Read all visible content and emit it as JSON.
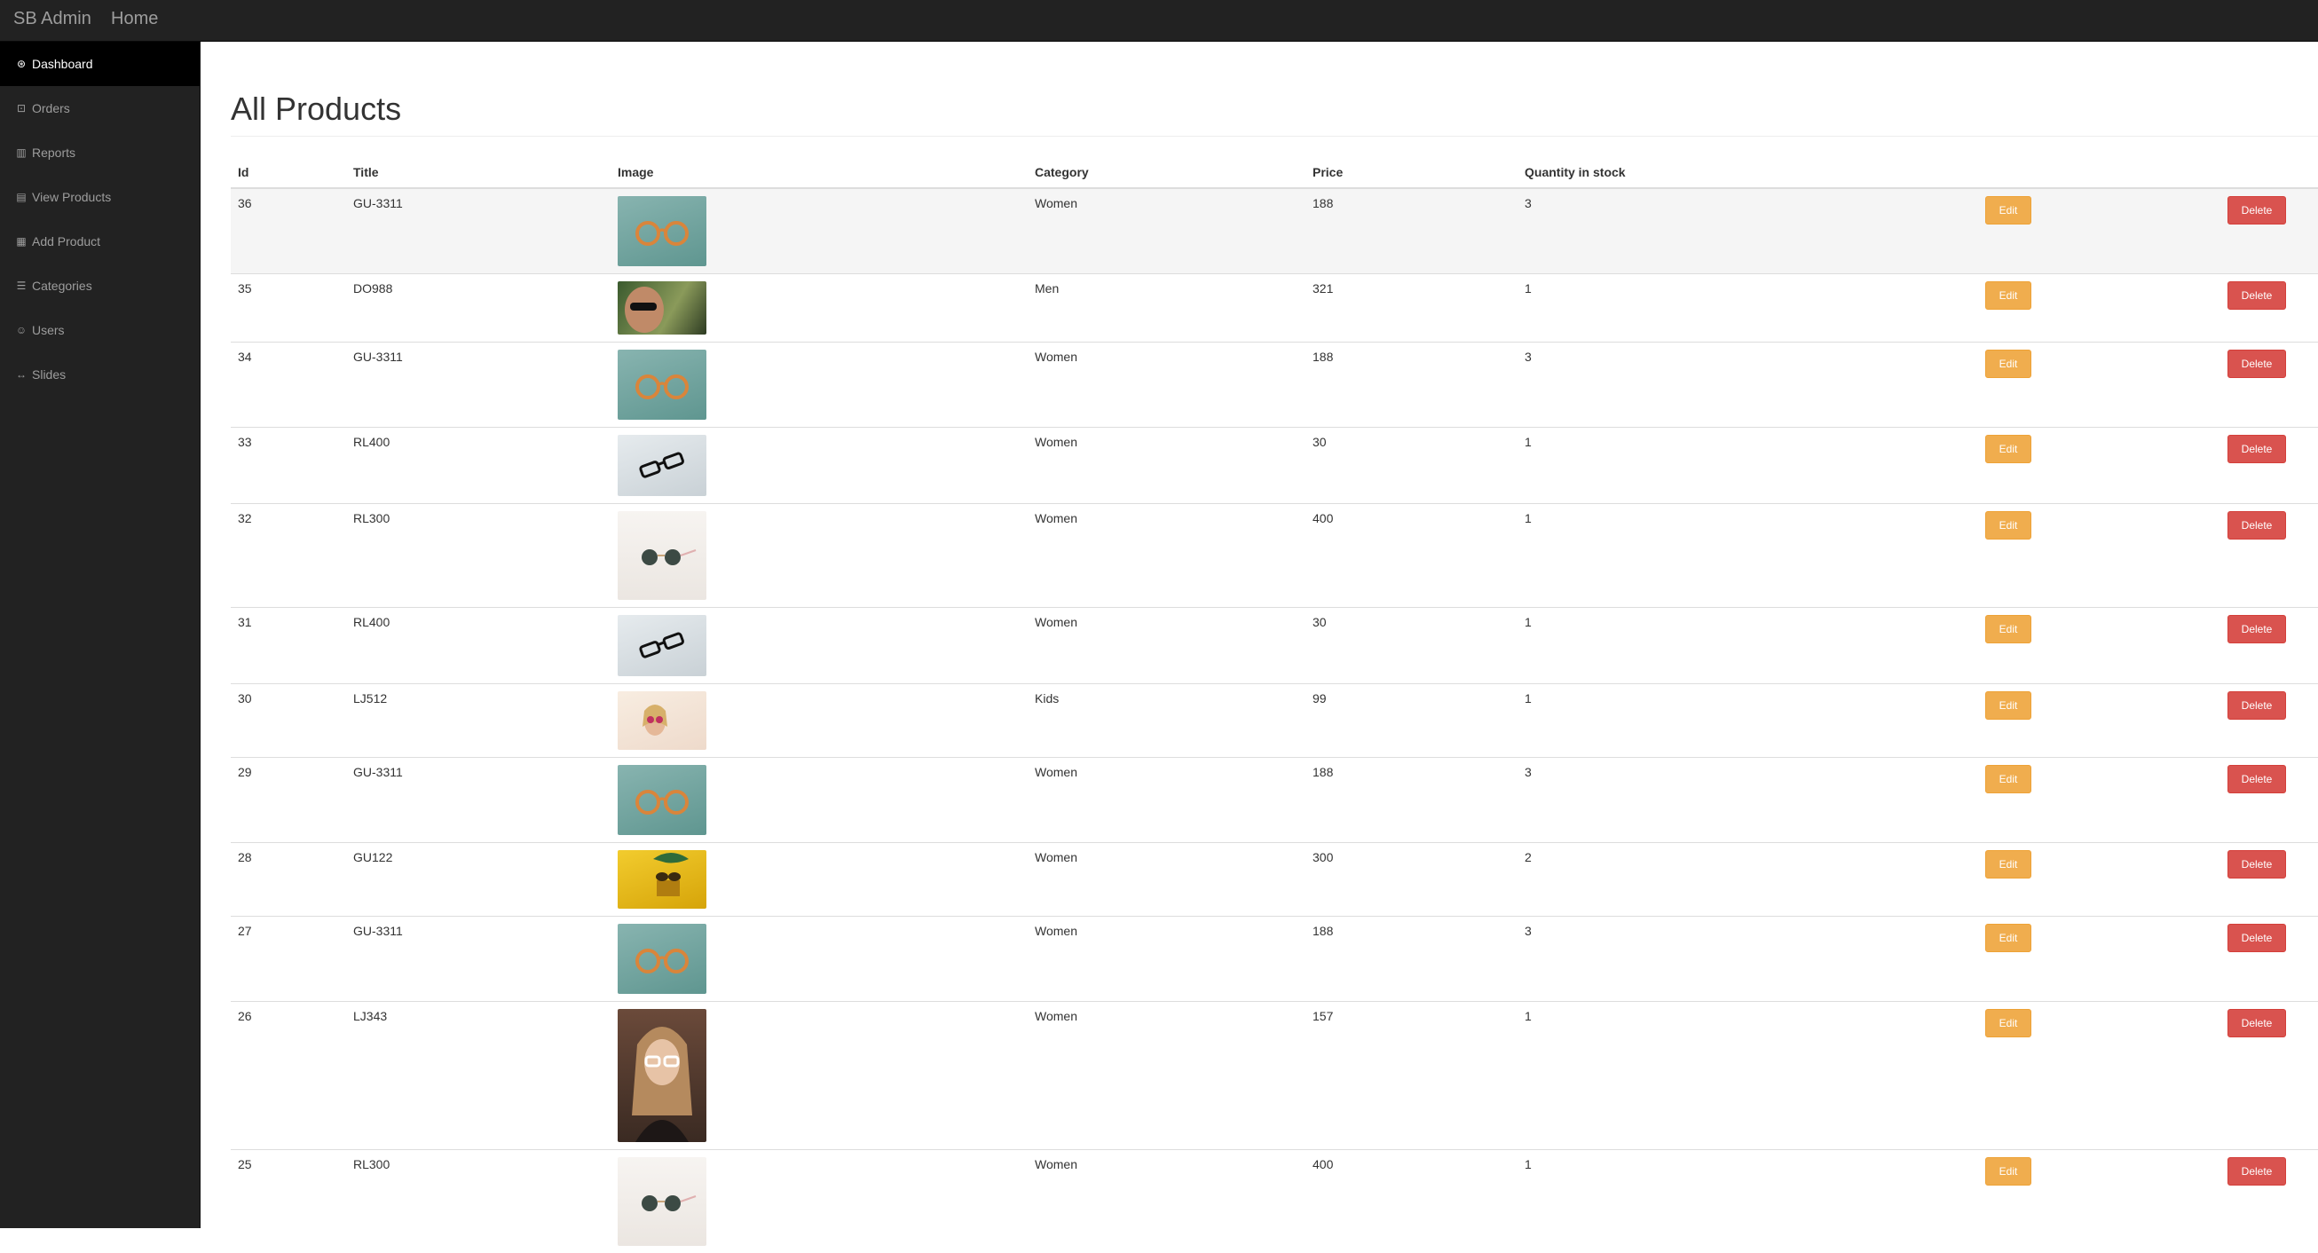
{
  "topbar": {
    "brand": "SB Admin",
    "home": "Home"
  },
  "sidebar": {
    "items": [
      {
        "label": "Dashboard",
        "icon": "dashboard-icon",
        "glyph": "⊛",
        "active": true
      },
      {
        "label": "Orders",
        "icon": "inbox-icon",
        "glyph": "⊡",
        "active": false
      },
      {
        "label": "Reports",
        "icon": "bar-chart-icon",
        "glyph": "▥",
        "active": false
      },
      {
        "label": "View Products",
        "icon": "file-icon",
        "glyph": "▤",
        "active": false
      },
      {
        "label": "Add Product",
        "icon": "table-icon",
        "glyph": "▦",
        "active": false
      },
      {
        "label": "Categories",
        "icon": "list-icon",
        "glyph": "☰",
        "active": false
      },
      {
        "label": "Users",
        "icon": "users-icon",
        "glyph": "☺",
        "active": false
      },
      {
        "label": "Slides",
        "icon": "arrows-h-icon",
        "glyph": "↔",
        "active": false
      }
    ]
  },
  "main": {
    "title": "All Products"
  },
  "table": {
    "headers": {
      "id": "Id",
      "title": "Title",
      "image": "Image",
      "category": "Category",
      "price": "Price",
      "qty": "Quantity in stock"
    },
    "edit_label": "Edit",
    "delete_label": "Delete",
    "rows": [
      {
        "id": "36",
        "title": "GU-3311",
        "category": "Women",
        "price": "188",
        "qty": "3",
        "image": "orange-glasses-teal"
      },
      {
        "id": "35",
        "title": "DO988",
        "category": "Men",
        "price": "321",
        "qty": "1",
        "image": "man-sunglasses-forest"
      },
      {
        "id": "34",
        "title": "GU-3311",
        "category": "Women",
        "price": "188",
        "qty": "3",
        "image": "orange-glasses-teal"
      },
      {
        "id": "33",
        "title": "RL400",
        "category": "Women",
        "price": "30",
        "qty": "1",
        "image": "black-glasses-grey"
      },
      {
        "id": "32",
        "title": "RL300",
        "category": "Women",
        "price": "400",
        "qty": "1",
        "image": "round-sunglasses-white"
      },
      {
        "id": "31",
        "title": "RL400",
        "category": "Women",
        "price": "30",
        "qty": "1",
        "image": "black-glasses-grey"
      },
      {
        "id": "30",
        "title": "LJ512",
        "category": "Kids",
        "price": "99",
        "qty": "1",
        "image": "girl-sunglasses-cream"
      },
      {
        "id": "29",
        "title": "GU-3311",
        "category": "Women",
        "price": "188",
        "qty": "3",
        "image": "orange-glasses-teal"
      },
      {
        "id": "28",
        "title": "GU122",
        "category": "Women",
        "price": "300",
        "qty": "2",
        "image": "sunglasses-yellow"
      },
      {
        "id": "27",
        "title": "GU-3311",
        "category": "Women",
        "price": "188",
        "qty": "3",
        "image": "orange-glasses-teal"
      },
      {
        "id": "26",
        "title": "LJ343",
        "category": "Women",
        "price": "157",
        "qty": "1",
        "image": "woman-glasses-portrait"
      },
      {
        "id": "25",
        "title": "RL300",
        "category": "Women",
        "price": "400",
        "qty": "1",
        "image": "round-sunglasses-white"
      }
    ]
  }
}
